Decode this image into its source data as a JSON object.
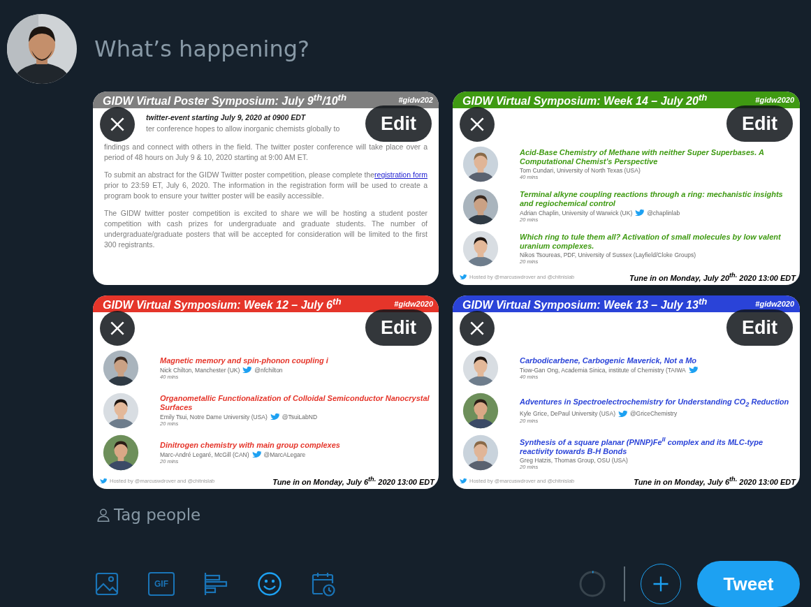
{
  "composer": {
    "placeholder": "What’s happening?"
  },
  "media": [
    {
      "kind": "notice",
      "color": "#7f7f7f",
      "title": "GIDW Virtual Poster Symposium: July 9$^{th}$/10$^{th}$",
      "hashtag": "#gidw202",
      "edit_label": "Edit",
      "subtitle": "twitter-event starting July 9, 2020 at 0900 EDT",
      "intro_line": "ter conference hopes to allow inorganic chemists globally to",
      "paragraphs": [
        {
          "text": "findings and connect with others in the field. The twitter poster conference will take place over a period of 48 hours on July 9 & 10, 2020 starting at 9:00 AM ET."
        },
        {
          "text": "To submit an abstract for the GIDW Twitter poster competition, please complete the",
          "link": "registration form",
          "after": "prior to 23:59 ET, July 6, 2020. The information in the registration form will be used to create a program book to ensure your twitter poster will be easily accessible."
        },
        {
          "text": "The GIDW twitter poster competition is excited to share we will be hosting a student poster competition with cash prizes for undergraduate and graduate students. The number of undergraduate/graduate posters that will be accepted for consideration will be limited to the first 300 registrants."
        }
      ]
    },
    {
      "kind": "program",
      "color": "#3f9a12",
      "title": "GIDW Virtual Symposium: Week 14 – July 20$^{th}$",
      "hashtag": "#gidw2020",
      "edit_label": "Edit",
      "sessions": [
        {
          "title": "Acid-Base Chemistry of Methane with neither Super Superbases. A Computational Chemist’s Perspective",
          "speaker": "Tom Cundari, University of North Texas (USA)",
          "twitter": false,
          "duration": "40 mins"
        },
        {
          "title": "Terminal alkyne coupling reactions through a ring: mechanistic insights and regiochemical control",
          "speaker": "Adrian Chaplin, University of Warwick (UK)",
          "twitter": true,
          "handle": "@chaplinlab",
          "duration": "20 mins"
        },
        {
          "title": "Which ring to tule them all? Activation of small molecules by low valent uranium complexes.",
          "speaker": "Nikos Tsoureas, PDF, University of Sussex (Layfield/Cloke Groups)",
          "twitter": false,
          "duration": "20 mins"
        }
      ],
      "hosted": "Hosted by @marcuswdrover and @chitnislab",
      "tune": "Tune in on Monday, July 20$^{th.}$ 2020 13:00 EDT"
    },
    {
      "kind": "program",
      "color": "#e5352a",
      "title": "GIDW Virtual Symposium: Week 12 – July 6$^{th}$",
      "hashtag": "#gidw2020",
      "edit_label": "Edit",
      "sessions": [
        {
          "title": "Magnetic memory and spin-phonon coupling i",
          "speaker": "Nick Chilton, Manchester (UK)",
          "twitter": true,
          "handle": "@nfchilton",
          "duration": "40 mins"
        },
        {
          "title": "Organometallic Functionalization of Colloidal Semiconductor Nanocrystal Surfaces",
          "speaker": "Emily Tsui, Notre Dame University (USA)",
          "twitter": true,
          "handle": "@TsuiLabND",
          "duration": "20 mins"
        },
        {
          "title": "Dinitrogen chemistry with main group complexes",
          "speaker": "Marc-André Legaré, McGill (CAN)",
          "twitter": true,
          "handle": "@MarcALegare",
          "duration": "20 mins"
        }
      ],
      "hosted": "Hosted by @marcuswdrover and @chitnislab",
      "tune": "Tune in on Monday, July 6$^{th.}$ 2020 13:00 EDT"
    },
    {
      "kind": "program",
      "color": "#2a43d8",
      "title": "GIDW Virtual Symposium: Week 13 – July 13$^{th}$",
      "hashtag": "#gidw2020",
      "edit_label": "Edit",
      "sessions": [
        {
          "title": "Carbodicarbene, Carbogenic Maverick, Not a Mo",
          "speaker": "Tiow-Gan Ong, Academia Sinica, institute of Chemistry (TAIWA",
          "twitter": true,
          "duration": "40 mins"
        },
        {
          "title": "Adventures in Spectroelectrochemistry for Understanding CO$_{2}$ Reduction",
          "speaker": "Kyle Grice, DePaul University (USA)",
          "twitter": true,
          "handle": "@GriceChemistry",
          "duration": "20 mins"
        },
        {
          "title": "Synthesis of a square planar (PNNP)Fe$^{II}$ complex and its MLC-type reactivity towards B-H Bonds",
          "speaker": "Greg Hatzis, Thomas Group, OSU (USA)",
          "twitter": false,
          "duration": "20 mins"
        }
      ],
      "hosted": "Hosted by @marcuswdrover and @chitnislab",
      "tune": "Tune in on Monday, July 6$^{th.}$ 2020 13:00 EDT"
    }
  ],
  "tag_people": "Tag people",
  "toolbar": {
    "gif": "GIF",
    "tweet": "Tweet"
  }
}
